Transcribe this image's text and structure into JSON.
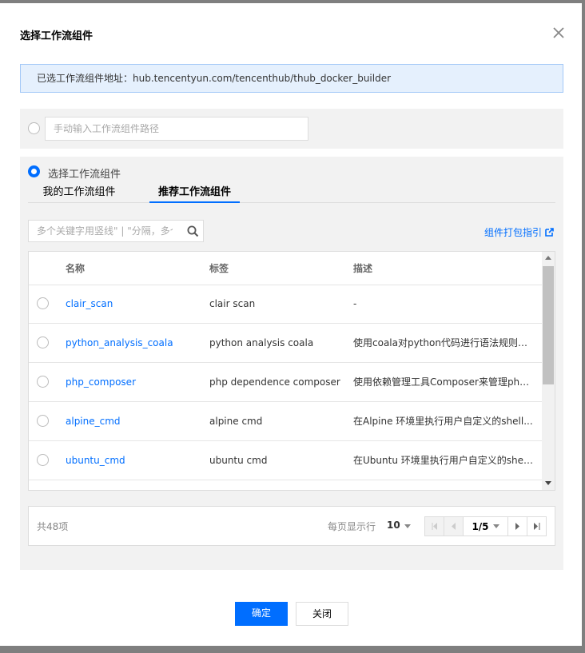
{
  "dialog": {
    "title": "选择工作流组件",
    "notice": "已选工作流组件地址：hub.tencentyun.com/tencenthub/thub_docker_builder"
  },
  "manual": {
    "placeholder": "手动输入工作流组件路径"
  },
  "select": {
    "label": "选择工作流组件",
    "tabs": [
      {
        "label": "我的工作流组件"
      },
      {
        "label": "推荐工作流组件"
      }
    ],
    "search_placeholder": "多个关键字用竖线\" | \"分隔，多个过滤标签用回车键分隔",
    "guide_link": "组件打包指引"
  },
  "table": {
    "headers": [
      "名称",
      "标签",
      "描述"
    ],
    "rows": [
      {
        "name": "clair_scan",
        "tag": "clair scan",
        "desc": "-"
      },
      {
        "name": "python_analysis_coala",
        "tag": "python analysis coala",
        "desc": "使用coala对python代码进行语法规则和..."
      },
      {
        "name": "php_composer",
        "tag": "php dependence composer",
        "desc": "使用依赖管理工具Composer来管理php..."
      },
      {
        "name": "alpine_cmd",
        "tag": "alpine cmd",
        "desc": "在Alpine 环境里执行用户自定义的shell..."
      },
      {
        "name": "ubuntu_cmd",
        "tag": "ubuntu cmd",
        "desc": "在Ubuntu 环境里执行用户自定义的shell..."
      }
    ]
  },
  "pagination": {
    "total": "共48项",
    "per_page_label": "每页显示行",
    "per_page": "10",
    "page": "1/5"
  },
  "footer": {
    "confirm": "确定",
    "close": "关闭"
  },
  "colors": {
    "accent": "#006eff",
    "notice_bg": "#e5f0fd",
    "section_bg": "#f2f2f2"
  }
}
